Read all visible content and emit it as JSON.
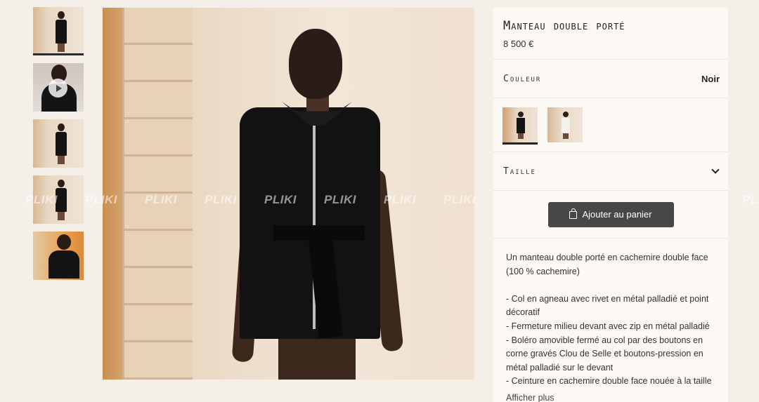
{
  "gallery": {
    "thumbnails": [
      {
        "label": "Vue de face",
        "type": "image",
        "active": true
      },
      {
        "label": "Vidéo",
        "type": "video",
        "active": false
      },
      {
        "label": "Vue de côté",
        "type": "image",
        "active": false
      },
      {
        "label": "Vue en pied",
        "type": "image",
        "active": false
      },
      {
        "label": "Détail col",
        "type": "image",
        "active": false
      }
    ],
    "main_image_icon": "model-photo-icon",
    "watermark": [
      "PLIKI",
      "PLIKI",
      "PLIKI",
      "PLIKI",
      "PLIKI",
      "PLIKI",
      "PLIKI",
      "PLIKI",
      "PLIKI",
      "PLIKI",
      "PLIKI",
      "PLIKI",
      "PLIKI"
    ]
  },
  "product": {
    "title": "Manteau double porté",
    "price": "8 500 €",
    "color_label": "Couleur",
    "color_value": "Noir",
    "size_label": "Taille",
    "add_to_cart": "Ajouter au panier",
    "description": [
      "Un manteau double porté en cachemire double face (100 % cachemire)",
      "",
      "- Col en agneau avec rivet en métal palladié et point décoratif",
      "- Fermeture milieu devant avec zip en métal palladié",
      "- Boléro amovible fermé au col par des boutons en corne gravés Clou de Selle et boutons-pression en métal palladié sur le devant",
      "- Ceinture en cachemire double face nouée à la taille"
    ],
    "show_more": "Afficher plus"
  },
  "colors": {
    "background": "#f4efe8",
    "panel": "#fcf9f5",
    "button": "#474747"
  }
}
